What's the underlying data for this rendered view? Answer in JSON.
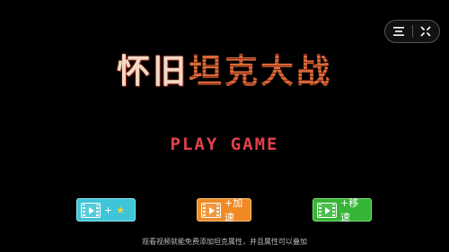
{
  "title": {
    "part1": "怀旧",
    "part2": "坦克大战"
  },
  "play_label": "PLAY GAME",
  "buttons": [
    {
      "label": "+ ",
      "icon": "video-icon",
      "badge_icon": "star-icon",
      "color": "#3fc4d8"
    },
    {
      "label": "+加速",
      "icon": "video-icon",
      "color": "#f08a24"
    },
    {
      "label": "+移速",
      "icon": "video-icon",
      "color": "#34b534"
    }
  ],
  "hint": "观看视频就能免费添加坦克属性，并且属性可以叠加",
  "capsule": {
    "menu_icon": "menu-icon",
    "close_icon": "close-icon"
  }
}
